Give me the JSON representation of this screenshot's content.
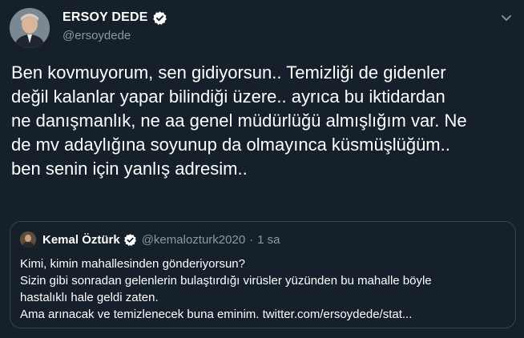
{
  "author": {
    "display_name": "ERSOY DEDE",
    "handle": "@ersoydede",
    "verified": true
  },
  "tweet": {
    "lines": [
      "Ben kovmuyorum, sen gidiyorsun.. Temizliği de gidenler",
      "değil kalanlar yapar bilindiği üzere.. ayrıca bu iktidardan",
      "ne danışmanlık, ne aa genel müdürlüğü almışlığım var. Ne",
      "de mv adaylığına soyunup da olmayınca küsmüşlüğüm..",
      "ben senin için yanlış adresim.."
    ]
  },
  "quoted_tweet": {
    "display_name": "Kemal Öztürk",
    "handle": "@kemalozturk2020",
    "separator": "·",
    "time": "1 sa",
    "verified": true,
    "lines": [
      "Kimi, kimin mahallesinden gönderiyorsun?",
      "Sizin gibi sonradan gelenlerin bulaştırdığı virüsler yüzünden bu mahalle böyle",
      "hastalıklı hale geldi zaten.",
      "Ama arınacak ve temizlenecek buna eminim. twitter.com/ersoydede/stat..."
    ]
  },
  "icons": {
    "verified": "verified-badge-icon",
    "caret": "chevron-down-icon"
  },
  "colors": {
    "background": "#15202b",
    "text": "#ffffff",
    "secondary_text": "#8899a6",
    "border": "#38444d",
    "verified_bg": "#ffffff",
    "verified_check": "#15202b"
  }
}
